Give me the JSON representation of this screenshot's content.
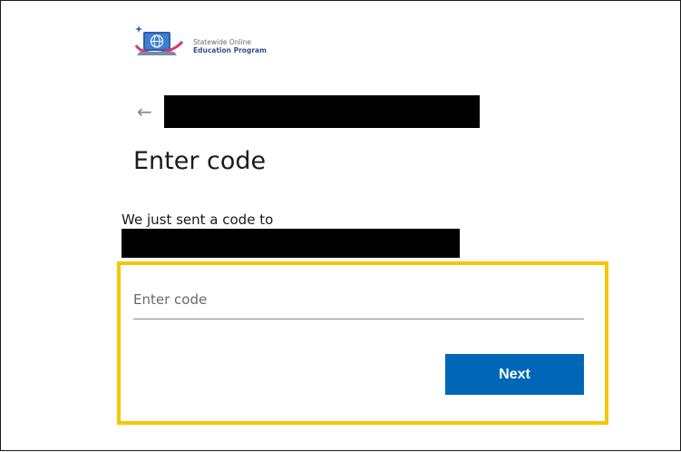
{
  "logo": {
    "line1": "Statewide Online",
    "line2": "Education Program"
  },
  "header": {
    "back_icon": "back-arrow-icon",
    "back_glyph": "←"
  },
  "title": "Enter code",
  "description": "We just sent a code to",
  "code_input": {
    "placeholder": "Enter code",
    "value": ""
  },
  "next_button": {
    "label": "Next"
  },
  "colors": {
    "accent": "#0067b8",
    "highlight": "#f6c600",
    "logo_pink": "#d9367a",
    "logo_blue": "#2f5fa8"
  }
}
